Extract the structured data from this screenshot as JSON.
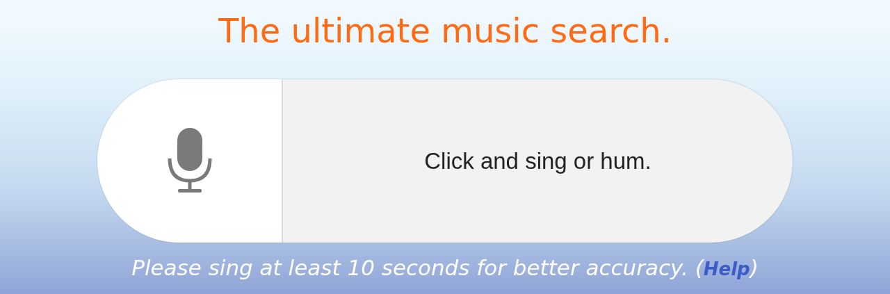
{
  "heading": "The ultimate music search.",
  "recorder": {
    "prompt": "Click and sing or hum."
  },
  "hint": {
    "before": "Please sing at least 10 seconds for better accuracy. (",
    "link": "Help",
    "after": ")"
  }
}
